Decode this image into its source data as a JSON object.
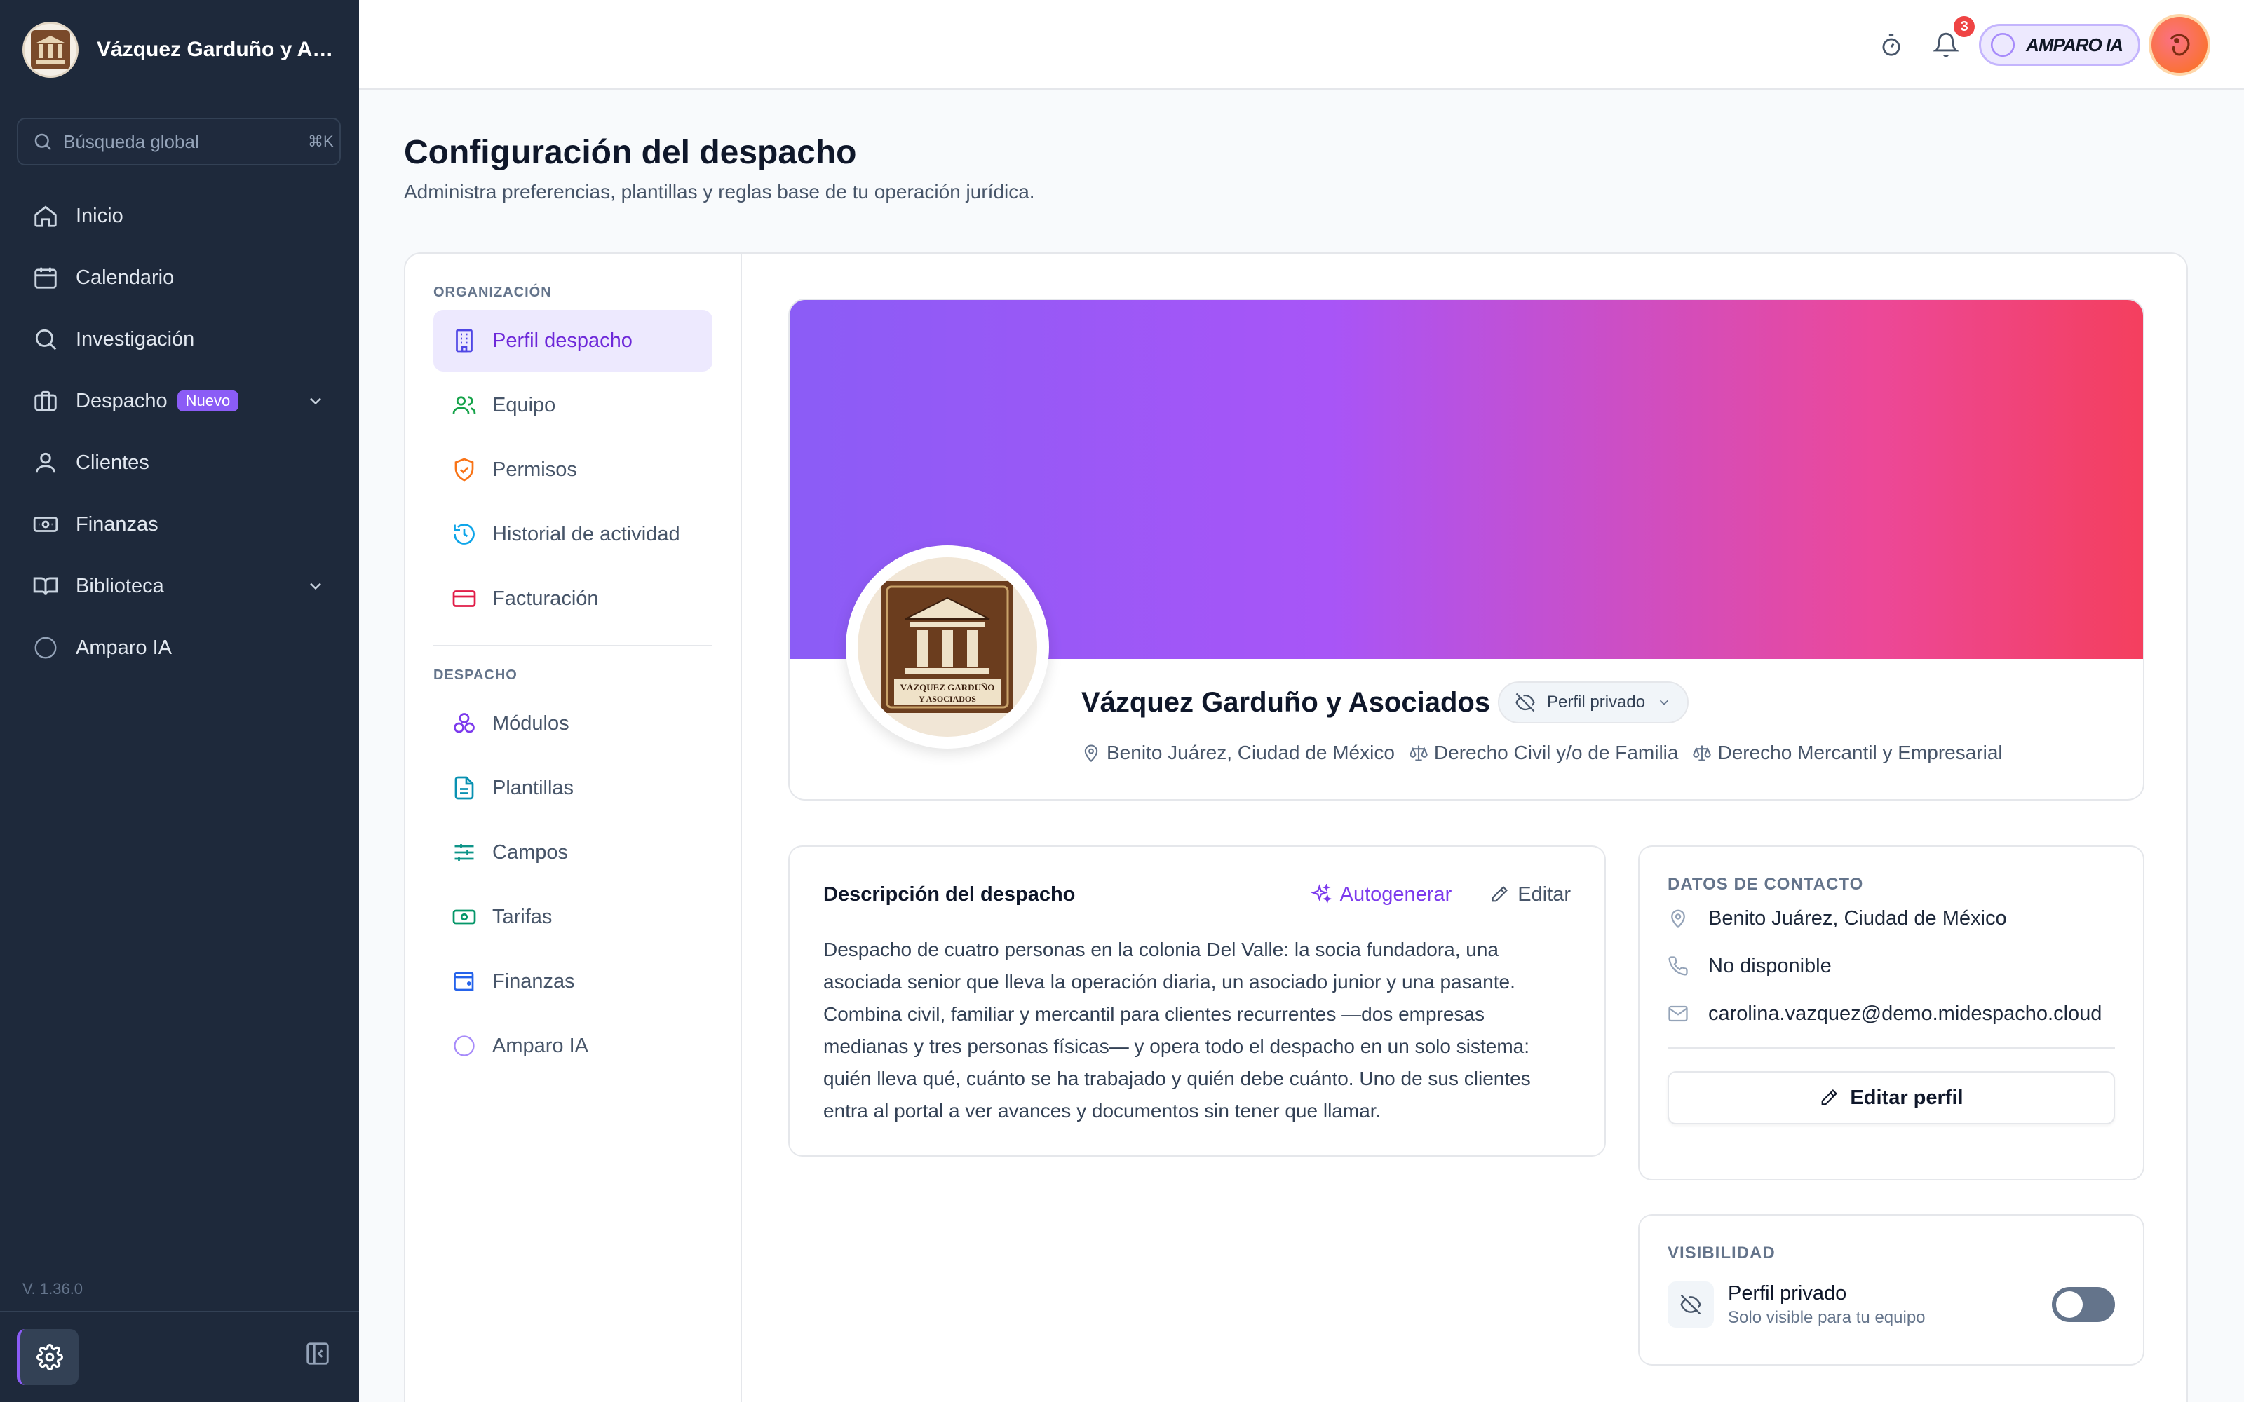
{
  "sidebar": {
    "firm_name": "Vázquez Garduño y Asociados",
    "search_placeholder": "Búsqueda global",
    "search_shortcut": "⌘K",
    "nav": [
      {
        "label": "Inicio",
        "icon": "home-icon"
      },
      {
        "label": "Calendario",
        "icon": "calendar-icon"
      },
      {
        "label": "Investigación",
        "icon": "search-icon"
      },
      {
        "label": "Despacho",
        "icon": "briefcase-icon",
        "badge": "Nuevo",
        "expandable": true
      },
      {
        "label": "Clientes",
        "icon": "user-icon"
      },
      {
        "label": "Finanzas",
        "icon": "banknote-icon"
      },
      {
        "label": "Biblioteca",
        "icon": "book-icon",
        "expandable": true
      },
      {
        "label": "Amparo IA",
        "icon": "circle-icon"
      }
    ],
    "version": "V. 1.36.0"
  },
  "topbar": {
    "notification_count": "3",
    "assistant_label": "AMPARO IA"
  },
  "page": {
    "title": "Configuración del despacho",
    "subtitle": "Administra preferencias, plantillas y reglas base de tu operación jurídica."
  },
  "settings_nav": {
    "org_label": "ORGANIZACIÓN",
    "org_items": [
      {
        "label": "Perfil despacho",
        "icon": "building-icon",
        "active": true
      },
      {
        "label": "Equipo",
        "icon": "users-icon"
      },
      {
        "label": "Permisos",
        "icon": "shield-icon"
      },
      {
        "label": "Historial de actividad",
        "icon": "history-icon"
      },
      {
        "label": "Facturación",
        "icon": "credit-card-icon"
      }
    ],
    "firm_label": "DESPACHO",
    "firm_items": [
      {
        "label": "Módulos",
        "icon": "modules-icon"
      },
      {
        "label": "Plantillas",
        "icon": "file-text-icon"
      },
      {
        "label": "Campos",
        "icon": "sliders-icon"
      },
      {
        "label": "Tarifas",
        "icon": "banknote-icon"
      },
      {
        "label": "Finanzas",
        "icon": "wallet-icon"
      },
      {
        "label": "Amparo IA",
        "icon": "circle-icon"
      }
    ]
  },
  "profile": {
    "name": "Vázquez Garduño y Asociados",
    "privacy_label": "Perfil privado",
    "location": "Benito Juárez, Ciudad de México",
    "practice_area_1": "Derecho Civil y/o de Familia",
    "practice_area_2": "Derecho Mercantil y Empresarial",
    "logo_text_line1": "VÁZQUEZ GARDUÑO",
    "logo_text_line2": "Y ASOCIADOS"
  },
  "description": {
    "title": "Descripción del despacho",
    "autogenerate_label": "Autogenerar",
    "edit_label": "Editar",
    "text": "Despacho de cuatro personas en la colonia Del Valle: la socia fundadora, una asociada senior que lleva la operación diaria, un asociado junior y una pasante. Combina civil, familiar y mercantil para clientes recurrentes —dos empresas medianas y tres personas físicas— y opera todo el despacho en un solo sistema: quién lleva qué, cuánto se ha trabajado y quién debe cuánto. Uno de sus clientes entra al portal a ver avances y documentos sin tener que llamar."
  },
  "contact": {
    "label": "DATOS DE CONTACTO",
    "address": "Benito Juárez, Ciudad de México",
    "phone": "No disponible",
    "email": "carolina.vazquez@demo.midespacho.cloud",
    "edit_button": "Editar perfil"
  },
  "visibility": {
    "label": "VISIBILIDAD",
    "title": "Perfil privado",
    "subtitle": "Solo visible para tu equipo",
    "enabled": false
  },
  "colors": {
    "sidebar_bg": "#1e293b",
    "accent": "#7c3aed",
    "cover_gradient_start": "#8b5cf6",
    "cover_gradient_end": "#f43f5e"
  }
}
